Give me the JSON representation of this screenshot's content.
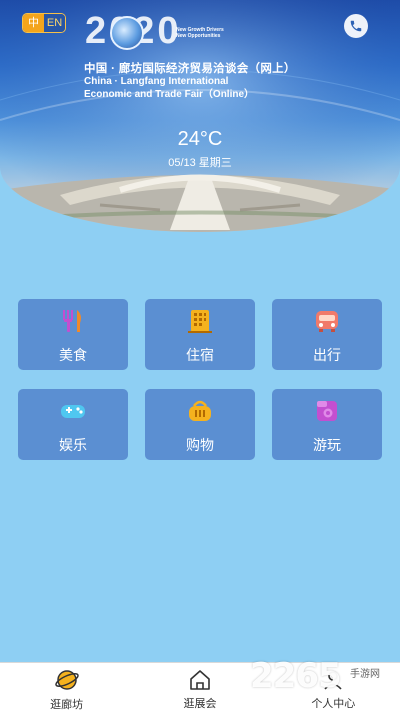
{
  "header": {
    "lang_zh": "中",
    "lang_en": "EN",
    "year_logo": "2020",
    "slogan_line1": "New Growth Drivers",
    "slogan_line2": "New Opportunities",
    "title_cn": "中国 · 廊坊国际经济贸易洽谈会（网上）",
    "title_en_line1": "China · Langfang International",
    "title_en_line2": "Economic and Trade Fair（Online）",
    "phone_icon": "phone-icon"
  },
  "weather": {
    "temperature": "24°C",
    "date": "05/13 星期三"
  },
  "services": [
    {
      "label": "美食",
      "icon": "fork-knife-icon"
    },
    {
      "label": "住宿",
      "icon": "hotel-building-icon"
    },
    {
      "label": "出行",
      "icon": "bus-icon"
    },
    {
      "label": "娱乐",
      "icon": "gamepad-icon"
    },
    {
      "label": "购物",
      "icon": "shopping-basket-icon"
    },
    {
      "label": "游玩",
      "icon": "camera-icon"
    }
  ],
  "tabbar": {
    "tabs": [
      {
        "label": "逛廊坊",
        "icon": "planet-icon"
      },
      {
        "label": "逛展会",
        "icon": "home-icon"
      },
      {
        "label": "个人中心",
        "icon": "person-icon"
      }
    ]
  },
  "watermark": {
    "text": "2265",
    "sub": "手游网"
  },
  "colors": {
    "page_bg": "#8ecff3",
    "tile_bg": "#5b8fd2",
    "tabbar_bg": "#ffffff"
  }
}
